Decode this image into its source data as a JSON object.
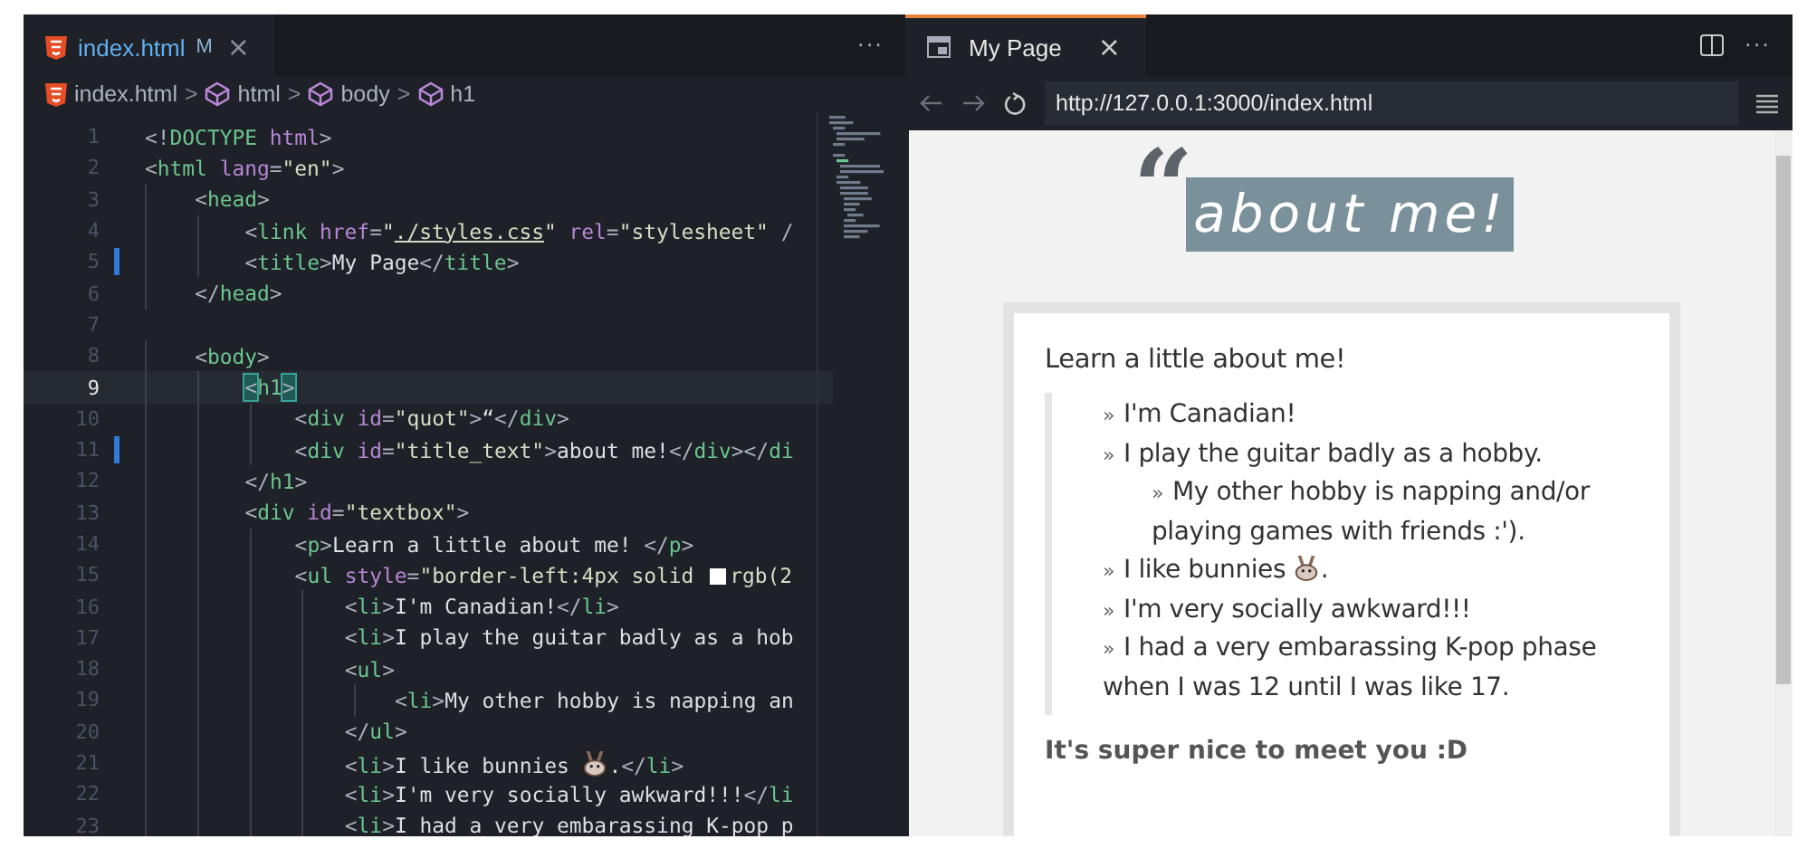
{
  "editor": {
    "tab": {
      "filename": "index.html",
      "status": "M",
      "close": "×",
      "selected": true
    },
    "more": "···",
    "breadcrumb": [
      {
        "label": "index.html",
        "kind": "file"
      },
      {
        "label": "html",
        "kind": "element"
      },
      {
        "label": "body",
        "kind": "element"
      },
      {
        "label": "h1",
        "kind": "element"
      }
    ],
    "separator": ">",
    "lines": [
      {
        "number": "1",
        "current": false,
        "modified": false,
        "tokens": [
          {
            "kind": "p",
            "text": "<!"
          },
          {
            "kind": "kw",
            "text": "DOCTYPE "
          },
          {
            "kind": "attr",
            "text": "html"
          },
          {
            "kind": "p",
            "text": ">"
          }
        ]
      },
      {
        "number": "2",
        "current": false,
        "modified": false,
        "tokens": [
          {
            "kind": "p",
            "text": "<"
          },
          {
            "kind": "tag",
            "text": "html"
          },
          {
            "kind": "attr",
            "text": " lang"
          },
          {
            "kind": "p",
            "text": "="
          },
          {
            "kind": "str",
            "text": "\"en\""
          },
          {
            "kind": "p",
            "text": ">"
          }
        ]
      },
      {
        "number": "3",
        "current": false,
        "modified": false,
        "tokens": [
          {
            "kind": "p",
            "text": "    <"
          },
          {
            "kind": "tag",
            "text": "head"
          },
          {
            "kind": "p",
            "text": ">"
          }
        ]
      },
      {
        "number": "4",
        "current": false,
        "modified": false,
        "tokens": [
          {
            "kind": "p",
            "text": "        <"
          },
          {
            "kind": "tag",
            "text": "link"
          },
          {
            "kind": "attr",
            "text": " href"
          },
          {
            "kind": "p",
            "text": "="
          },
          {
            "kind": "str",
            "text": "\""
          },
          {
            "kind": "link",
            "text": "./styles.css"
          },
          {
            "kind": "str",
            "text": "\""
          },
          {
            "kind": "attr",
            "text": " rel"
          },
          {
            "kind": "p",
            "text": "="
          },
          {
            "kind": "str",
            "text": "\"stylesheet\""
          },
          {
            "kind": "p",
            "text": " /"
          }
        ]
      },
      {
        "number": "5",
        "current": false,
        "modified": true,
        "tokens": [
          {
            "kind": "p",
            "text": "        <"
          },
          {
            "kind": "tag",
            "text": "title"
          },
          {
            "kind": "p",
            "text": ">"
          },
          {
            "kind": "text",
            "text": "My Page"
          },
          {
            "kind": "p",
            "text": "</"
          },
          {
            "kind": "tag",
            "text": "title"
          },
          {
            "kind": "p",
            "text": ">"
          }
        ]
      },
      {
        "number": "6",
        "current": false,
        "modified": false,
        "tokens": [
          {
            "kind": "p",
            "text": "    </"
          },
          {
            "kind": "tag",
            "text": "head"
          },
          {
            "kind": "p",
            "text": ">"
          }
        ]
      },
      {
        "number": "7",
        "current": false,
        "modified": false
      },
      {
        "number": "8",
        "current": false,
        "modified": false,
        "tokens": [
          {
            "kind": "p",
            "text": "    <"
          },
          {
            "kind": "tag",
            "text": "body"
          },
          {
            "kind": "p",
            "text": ">"
          }
        ]
      },
      {
        "number": "9",
        "current": true,
        "modified": false,
        "tokens": [
          {
            "kind": "bm",
            "text": "        <"
          },
          {
            "kind": "tag",
            "text": "h1"
          },
          {
            "kind": "bm",
            "text": ">"
          }
        ]
      },
      {
        "number": "10",
        "current": false,
        "modified": false,
        "tokens": [
          {
            "kind": "p",
            "text": "            <"
          },
          {
            "kind": "tag",
            "text": "div"
          },
          {
            "kind": "attr",
            "text": " id"
          },
          {
            "kind": "p",
            "text": "="
          },
          {
            "kind": "str",
            "text": "\"quot\""
          },
          {
            "kind": "p",
            "text": ">"
          },
          {
            "kind": "text",
            "text": "“"
          },
          {
            "kind": "p",
            "text": "</"
          },
          {
            "kind": "tag",
            "text": "div"
          },
          {
            "kind": "p",
            "text": ">"
          }
        ]
      },
      {
        "number": "11",
        "current": false,
        "modified": true,
        "tokens": [
          {
            "kind": "p",
            "text": "            <"
          },
          {
            "kind": "tag",
            "text": "div"
          },
          {
            "kind": "attr",
            "text": " id"
          },
          {
            "kind": "p",
            "text": "="
          },
          {
            "kind": "str",
            "text": "\"title_text\""
          },
          {
            "kind": "p",
            "text": ">"
          },
          {
            "kind": "text",
            "text": "about me!"
          },
          {
            "kind": "p",
            "text": "</"
          },
          {
            "kind": "tag",
            "text": "div"
          },
          {
            "kind": "p",
            "text": "></"
          },
          {
            "kind": "tag",
            "text": "di"
          }
        ]
      },
      {
        "number": "12",
        "current": false,
        "modified": false,
        "tokens": [
          {
            "kind": "p",
            "text": "        </"
          },
          {
            "kind": "tag",
            "text": "h1"
          },
          {
            "kind": "p",
            "text": ">"
          }
        ]
      },
      {
        "number": "13",
        "current": false,
        "modified": false,
        "tokens": [
          {
            "kind": "p",
            "text": "        <"
          },
          {
            "kind": "tag",
            "text": "div"
          },
          {
            "kind": "attr",
            "text": " id"
          },
          {
            "kind": "p",
            "text": "="
          },
          {
            "kind": "str",
            "text": "\"textbox\""
          },
          {
            "kind": "p",
            "text": ">"
          }
        ]
      },
      {
        "number": "14",
        "current": false,
        "modified": false,
        "tokens": [
          {
            "kind": "p",
            "text": "            <"
          },
          {
            "kind": "tag",
            "text": "p"
          },
          {
            "kind": "p",
            "text": ">"
          },
          {
            "kind": "text",
            "text": "Learn a little about me! "
          },
          {
            "kind": "p",
            "text": "</"
          },
          {
            "kind": "tag",
            "text": "p"
          },
          {
            "kind": "p",
            "text": ">"
          }
        ]
      },
      {
        "number": "15",
        "current": false,
        "modified": false,
        "tokens": [
          {
            "kind": "p",
            "text": "            <"
          },
          {
            "kind": "tag",
            "text": "ul"
          },
          {
            "kind": "attr",
            "text": " style"
          },
          {
            "kind": "p",
            "text": "="
          },
          {
            "kind": "str",
            "text": "\"border-left:4px solid "
          },
          {
            "kind": "swatch"
          },
          {
            "kind": "str",
            "text": "rgb(2"
          }
        ]
      },
      {
        "number": "16",
        "current": false,
        "modified": false,
        "tokens": [
          {
            "kind": "p",
            "text": "                <"
          },
          {
            "kind": "tag",
            "text": "li"
          },
          {
            "kind": "p",
            "text": ">"
          },
          {
            "kind": "text",
            "text": "I'm Canadian!"
          },
          {
            "kind": "p",
            "text": "</"
          },
          {
            "kind": "tag",
            "text": "li"
          },
          {
            "kind": "p",
            "text": ">"
          }
        ]
      },
      {
        "number": "17",
        "current": false,
        "modified": false,
        "tokens": [
          {
            "kind": "p",
            "text": "                <"
          },
          {
            "kind": "tag",
            "text": "li"
          },
          {
            "kind": "p",
            "text": ">"
          },
          {
            "kind": "text",
            "text": "I play the guitar badly as a hob"
          }
        ]
      },
      {
        "number": "18",
        "current": false,
        "modified": false,
        "tokens": [
          {
            "kind": "p",
            "text": "                <"
          },
          {
            "kind": "tag",
            "text": "ul"
          },
          {
            "kind": "p",
            "text": ">"
          }
        ]
      },
      {
        "number": "19",
        "current": false,
        "modified": false,
        "tokens": [
          {
            "kind": "p",
            "text": "                    <"
          },
          {
            "kind": "tag",
            "text": "li"
          },
          {
            "kind": "p",
            "text": ">"
          },
          {
            "kind": "text",
            "text": "My other hobby is napping an"
          }
        ]
      },
      {
        "number": "20",
        "current": false,
        "modified": false,
        "tokens": [
          {
            "kind": "p",
            "text": "                </"
          },
          {
            "kind": "tag",
            "text": "ul"
          },
          {
            "kind": "p",
            "text": ">"
          }
        ]
      },
      {
        "number": "21",
        "current": false,
        "modified": false,
        "tokens": [
          {
            "kind": "p",
            "text": "                <"
          },
          {
            "kind": "tag",
            "text": "li"
          },
          {
            "kind": "p",
            "text": ">"
          },
          {
            "kind": "text",
            "text": "I like bunnies "
          },
          {
            "kind": "icon"
          },
          {
            "kind": "text",
            "text": "."
          },
          {
            "kind": "p",
            "text": "</"
          },
          {
            "kind": "tag",
            "text": "li"
          },
          {
            "kind": "p",
            "text": ">"
          }
        ]
      },
      {
        "number": "22",
        "current": false,
        "modified": false,
        "tokens": [
          {
            "kind": "p",
            "text": "                <"
          },
          {
            "kind": "tag",
            "text": "li"
          },
          {
            "kind": "p",
            "text": ">"
          },
          {
            "kind": "text",
            "text": "I'm very socially awkward!!!"
          },
          {
            "kind": "p",
            "text": "</"
          },
          {
            "kind": "tag",
            "text": "li"
          }
        ]
      },
      {
        "number": "23",
        "current": false,
        "modified": false,
        "tokens": [
          {
            "kind": "p",
            "text": "                <"
          },
          {
            "kind": "tag",
            "text": "li"
          },
          {
            "kind": "p",
            "text": ">"
          },
          {
            "kind": "text",
            "text": "I had a very embarassing K-pop p"
          }
        ]
      }
    ]
  },
  "preview": {
    "tab": {
      "title": "My Page",
      "close": "×",
      "selected": true
    },
    "more": "···",
    "url": "http://127.0.0.1:3000/index.html",
    "page": {
      "quote": "“",
      "title": "about me!",
      "intro": "Learn a little about me!",
      "items": [
        {
          "marker": "»",
          "text": "I'm Canadian!"
        },
        {
          "marker": "»",
          "text": "I play the guitar badly as a hobby.",
          "children": [
            {
              "marker": "»",
              "text": "My other hobby is napping and/or playing games with friends :')."
            }
          ]
        },
        {
          "marker": "»",
          "text": "I like bunnies ",
          "emoji": true,
          "after": "."
        },
        {
          "marker": "»",
          "text": "I'm very socially awkward!!!"
        },
        {
          "marker": "»",
          "text": "I had a very embarassing K-pop phase when I was 12 until I was like 17."
        }
      ],
      "closing": "It's super nice to meet you :D"
    }
  }
}
